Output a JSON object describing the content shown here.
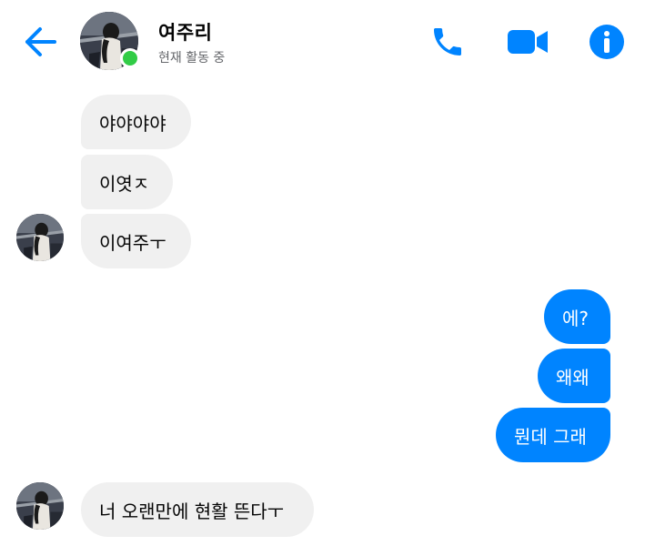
{
  "header": {
    "contact_name": "여주리",
    "status": "현재 활동 중",
    "icons": {
      "back": "back-arrow-icon",
      "call": "phone-icon",
      "video": "video-camera-icon",
      "info": "info-icon"
    },
    "accent_color": "#0084ff",
    "online_color": "#31cc46"
  },
  "messages": [
    {
      "sender": "contact",
      "text": "야야야야"
    },
    {
      "sender": "contact",
      "text": "이엿ㅈ"
    },
    {
      "sender": "contact",
      "text": "이여주ㅜ"
    },
    {
      "sender": "me",
      "text": "에?"
    },
    {
      "sender": "me",
      "text": "왜왜"
    },
    {
      "sender": "me",
      "text": "뭔데 그래"
    },
    {
      "sender": "contact",
      "text": "너 오랜만에 현활 뜬다ㅜ"
    }
  ]
}
